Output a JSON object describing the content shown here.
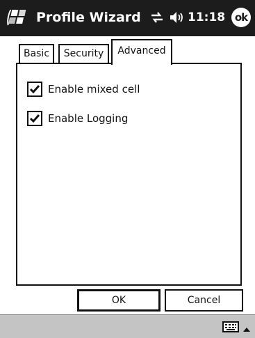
{
  "titlebar": {
    "title": "Profile Wizard",
    "time": "11:18",
    "ok_label": "ok",
    "icons": [
      "windows-start-icon",
      "connectivity-icon",
      "volume-icon"
    ]
  },
  "tabs": [
    {
      "label": "Basic",
      "selected": false
    },
    {
      "label": "Security",
      "selected": false
    },
    {
      "label": "Advanced",
      "selected": true
    }
  ],
  "options": [
    {
      "label": "Enable mixed cell",
      "checked": true
    },
    {
      "label": "Enable Logging",
      "checked": true
    }
  ],
  "buttons": {
    "ok_label": "OK",
    "cancel_label": "Cancel"
  },
  "bottombar": {
    "icons": [
      "keyboard-icon",
      "arrow-up-icon"
    ]
  }
}
